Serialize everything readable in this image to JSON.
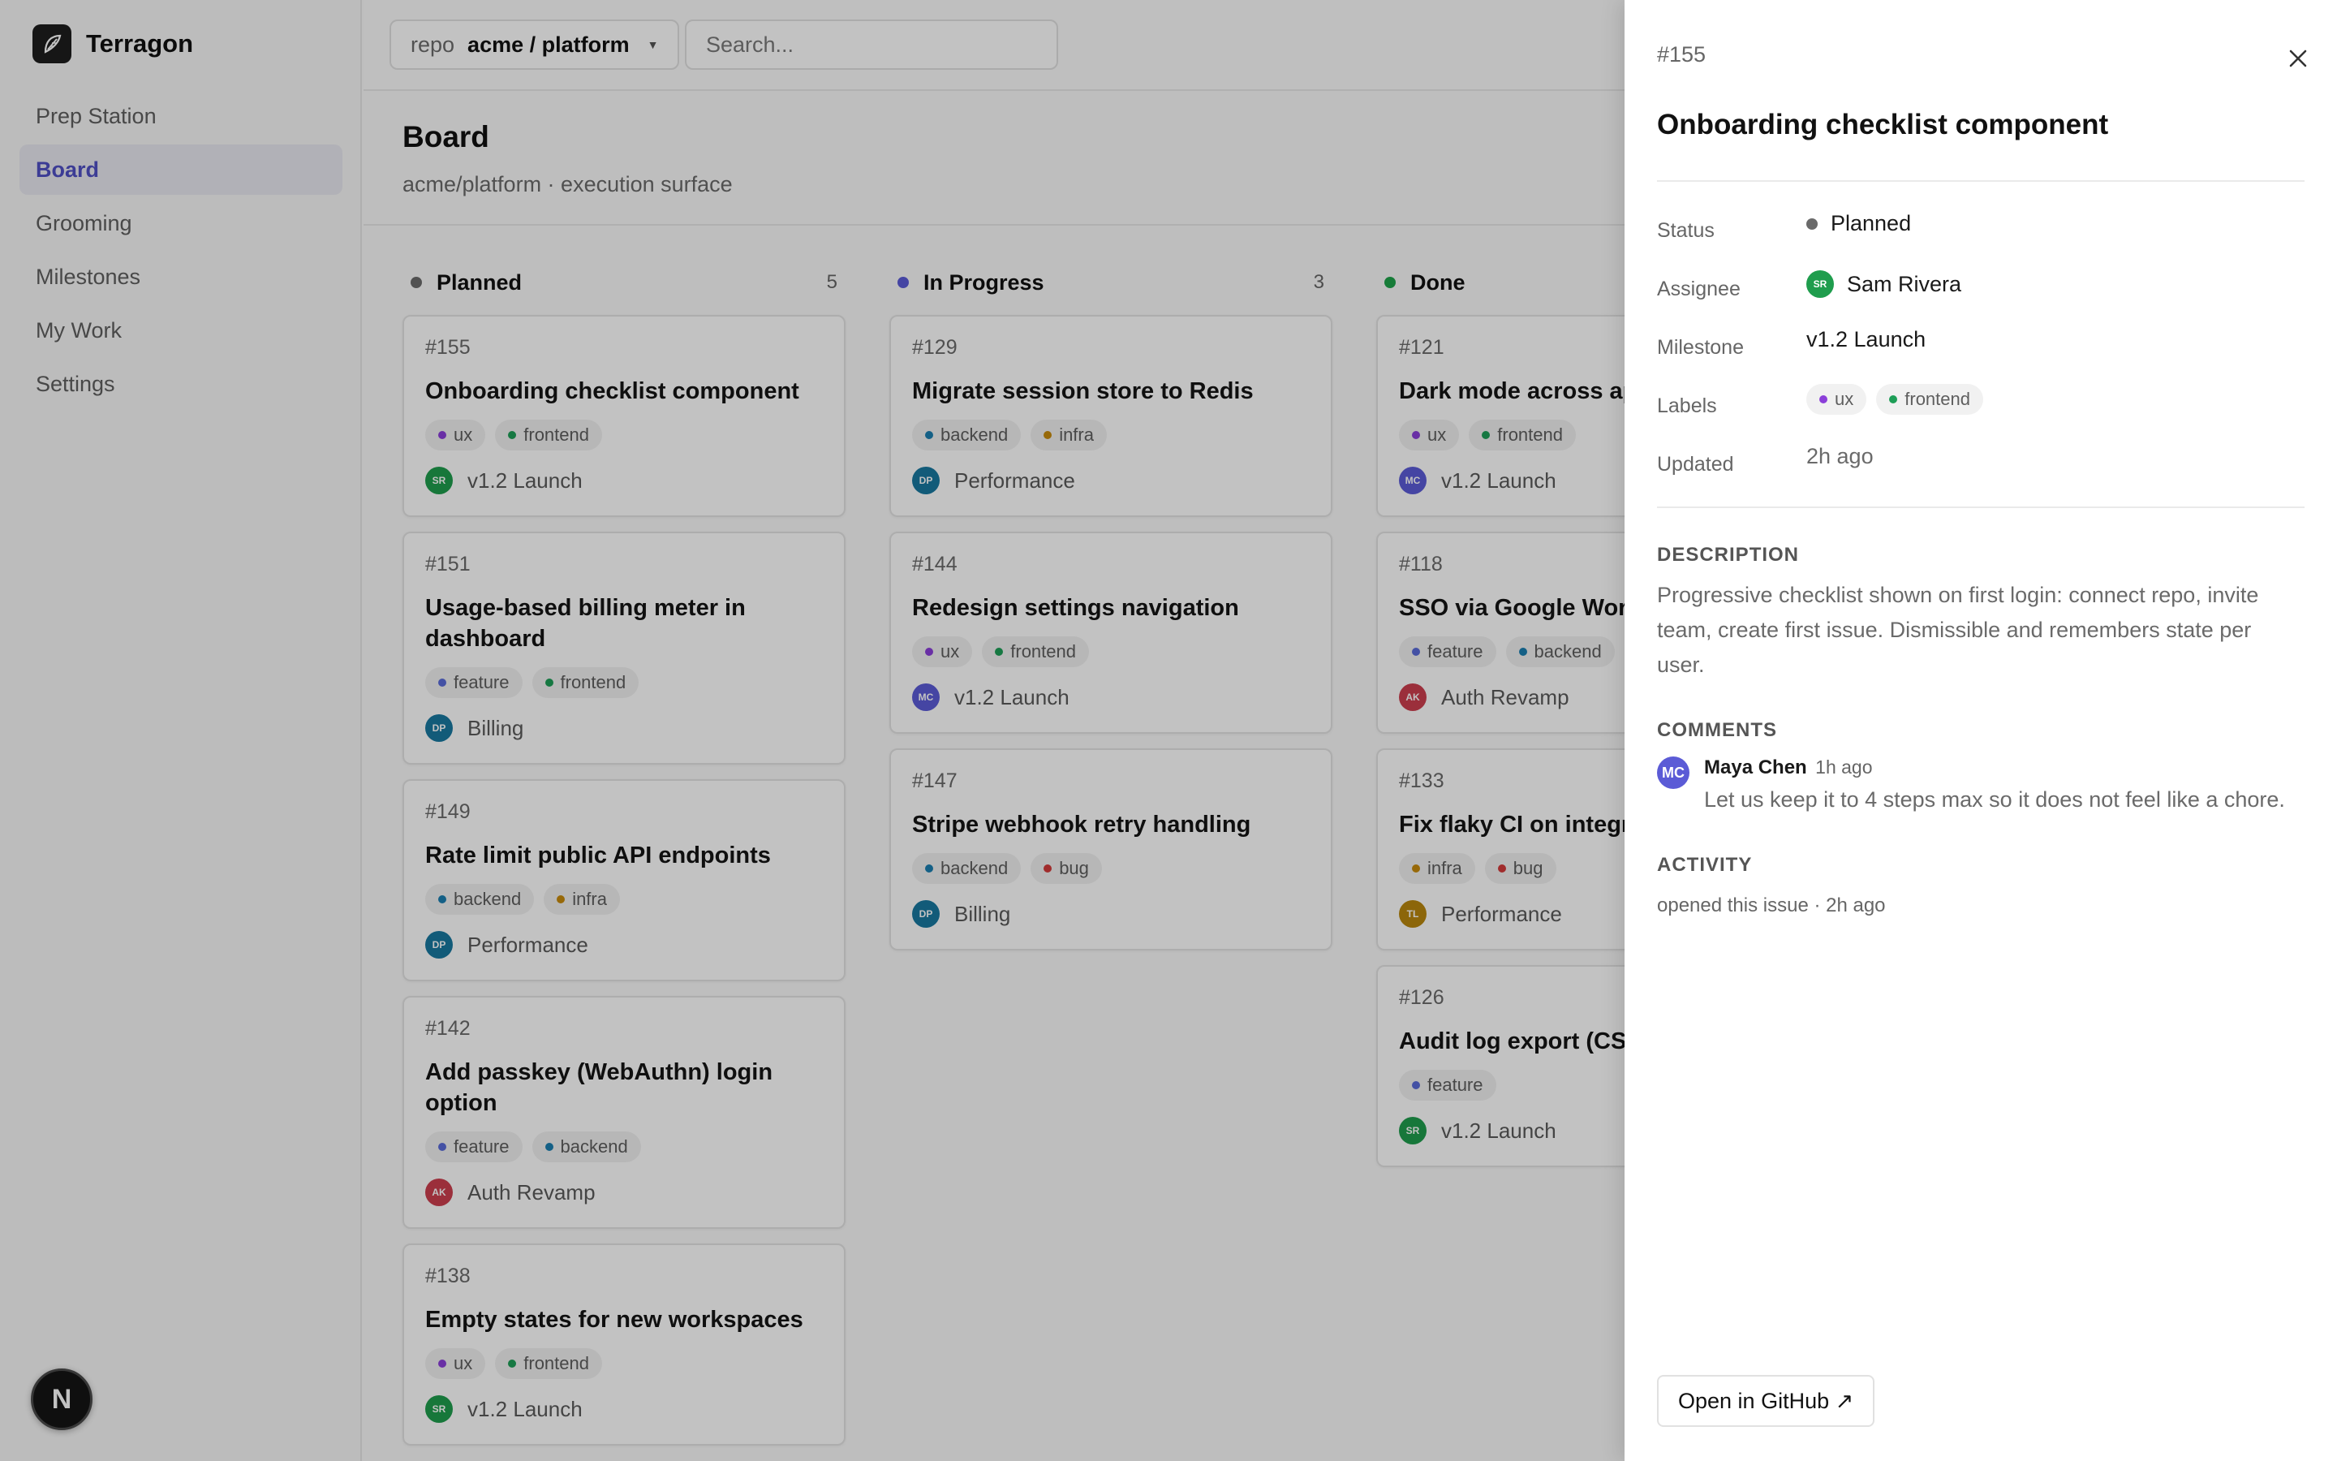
{
  "app": {
    "name": "Terragon"
  },
  "nav": [
    {
      "label": "Prep Station",
      "active": false
    },
    {
      "label": "Board",
      "active": true
    },
    {
      "label": "Grooming",
      "active": false
    },
    {
      "label": "Milestones",
      "active": false
    },
    {
      "label": "My Work",
      "active": false
    },
    {
      "label": "Settings",
      "active": false
    }
  ],
  "next_badge": {
    "letter": "N"
  },
  "topbar": {
    "repo_prefix": "repo",
    "repo_name": "acme / platform",
    "search_placeholder": "Search..."
  },
  "board": {
    "title": "Board",
    "subtitle": "acme/platform · execution surface"
  },
  "colors": {
    "accent": "#4f4fc4",
    "planned": "#6b6b6b",
    "in_progress": "#5b5bd6",
    "done": "#1fa34a",
    "tag_ux": "#8b3fd9",
    "tag_frontend": "#1e9e57",
    "tag_backend": "#1b7fb0",
    "tag_infra": "#c78a0c",
    "tag_feature": "#5a6bd8",
    "tag_bug": "#d33b3b",
    "avatar_SR": "#1f9d4d",
    "avatar_DP": "#1878a0",
    "avatar_MC": "#5b5bd6",
    "avatar_AK": "#cc3e4e",
    "avatar_TL": "#b8870e"
  },
  "columns": [
    {
      "name": "Planned",
      "color_key": "planned",
      "count": "5",
      "cards": [
        {
          "num": "#155",
          "title": "Onboarding checklist component",
          "tags": [
            "ux",
            "frontend"
          ],
          "avatar": "SR",
          "milestone": "v1.2 Launch"
        },
        {
          "num": "#151",
          "title": "Usage-based billing meter in dashboard",
          "tags": [
            "feature",
            "frontend"
          ],
          "avatar": "DP",
          "milestone": "Billing"
        },
        {
          "num": "#149",
          "title": "Rate limit public API endpoints",
          "tags": [
            "backend",
            "infra"
          ],
          "avatar": "DP",
          "milestone": "Performance"
        },
        {
          "num": "#142",
          "title": "Add passkey (WebAuthn) login option",
          "tags": [
            "feature",
            "backend"
          ],
          "avatar": "AK",
          "milestone": "Auth Revamp"
        },
        {
          "num": "#138",
          "title": "Empty states for new workspaces",
          "tags": [
            "ux",
            "frontend"
          ],
          "avatar": "SR",
          "milestone": "v1.2 Launch"
        }
      ]
    },
    {
      "name": "In Progress",
      "color_key": "in_progress",
      "count": "3",
      "cards": [
        {
          "num": "#129",
          "title": "Migrate session store to Redis",
          "tags": [
            "backend",
            "infra"
          ],
          "avatar": "DP",
          "milestone": "Performance"
        },
        {
          "num": "#144",
          "title": "Redesign settings navigation",
          "tags": [
            "ux",
            "frontend"
          ],
          "avatar": "MC",
          "milestone": "v1.2 Launch"
        },
        {
          "num": "#147",
          "title": "Stripe webhook retry handling",
          "tags": [
            "backend",
            "bug"
          ],
          "avatar": "DP",
          "milestone": "Billing"
        }
      ]
    },
    {
      "name": "Done",
      "color_key": "done",
      "count": "",
      "cards": [
        {
          "num": "#121",
          "title": "Dark mode across app",
          "tags": [
            "ux",
            "frontend"
          ],
          "avatar": "MC",
          "milestone": "v1.2 Launch"
        },
        {
          "num": "#118",
          "title": "SSO via Google Workspace",
          "tags": [
            "feature",
            "backend"
          ],
          "avatar": "AK",
          "milestone": "Auth Revamp"
        },
        {
          "num": "#133",
          "title": "Fix flaky CI on integration tests",
          "tags": [
            "infra",
            "bug"
          ],
          "avatar": "TL",
          "milestone": "Performance"
        },
        {
          "num": "#126",
          "title": "Audit log export (CSV)",
          "tags": [
            "feature"
          ],
          "avatar": "SR",
          "milestone": "v1.2 Launch"
        }
      ]
    }
  ],
  "detail": {
    "num": "#155",
    "title": "Onboarding checklist component",
    "props": {
      "status_label": "Status",
      "status": "Planned",
      "assignee_label": "Assignee",
      "assignee": "Sam Rivera",
      "assignee_initials": "SR",
      "milestone_label": "Milestone",
      "milestone": "v1.2 Launch",
      "labels_label": "Labels",
      "labels": [
        "ux",
        "frontend"
      ],
      "updated_label": "Updated",
      "updated": "2h ago"
    },
    "description_title": "DESCRIPTION",
    "description": "Progressive checklist shown on first login: connect repo, invite team, create first issue. Dismissible and remembers state per user.",
    "comments_title": "COMMENTS",
    "comment": {
      "initials": "MC",
      "author": "Maya Chen",
      "time": "1h ago",
      "text": "Let us keep it to 4 steps max so it does not feel like a chore."
    },
    "activity_title": "ACTIVITY",
    "activity": "opened this issue · 2h ago",
    "github_button": "Open in GitHub ↗"
  }
}
